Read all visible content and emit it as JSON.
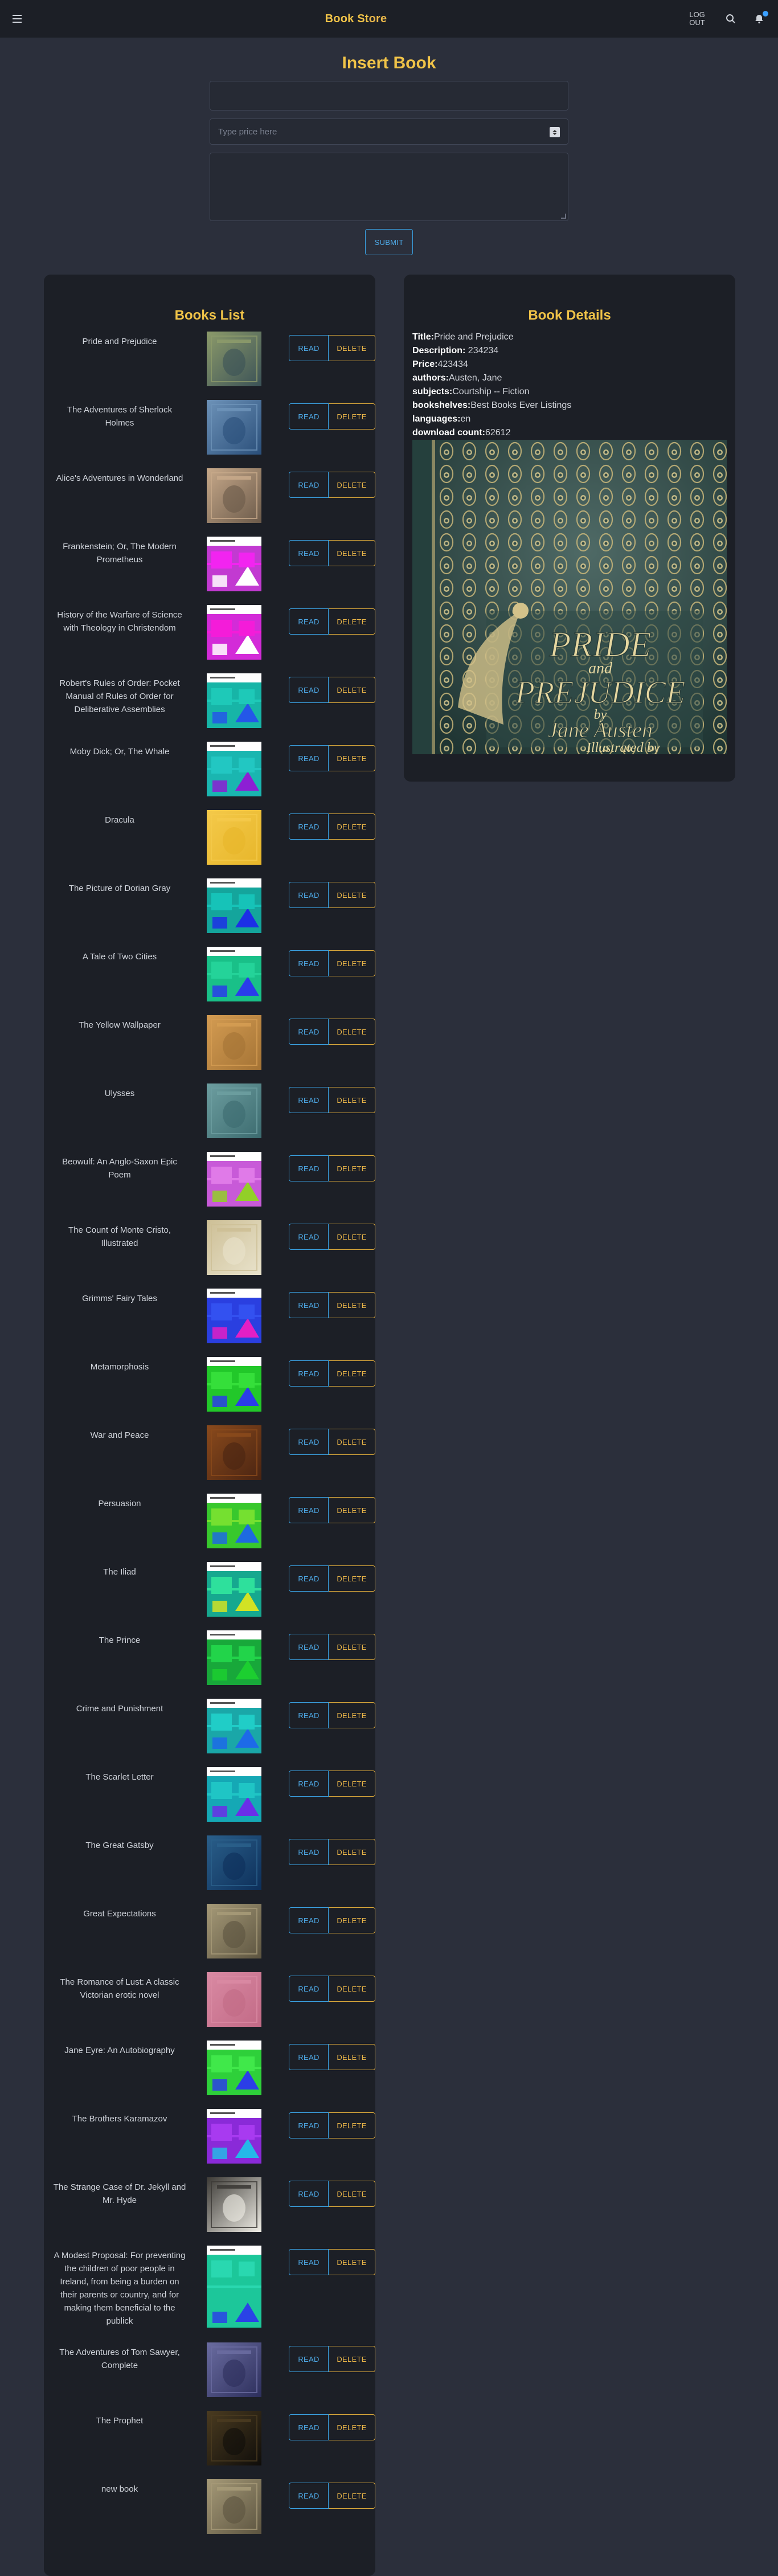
{
  "navbar": {
    "brand_main": "Book St",
    "brand_tail": "ore",
    "logout_line1": "LOG",
    "logout_line2": "OUT"
  },
  "insert_form": {
    "title": "Insert Book",
    "price_placeholder": "Type price here",
    "submit_label": "SUBMIT"
  },
  "books_list": {
    "title": "Books List",
    "read_label": "READ",
    "delete_label": "DELETE",
    "books": [
      {
        "title": "Pride and Prejudice",
        "cover": "photo",
        "c1": "#3b5257",
        "c2": "#8c9a6a"
      },
      {
        "title": "The Adventures of Sherlock Holmes",
        "cover": "photo",
        "c1": "#2a4f7a",
        "c2": "#6d92b8"
      },
      {
        "title": "Alice's Adventures in Wonderland",
        "cover": "photo",
        "c1": "#6b5a4a",
        "c2": "#c7a98a"
      },
      {
        "title": "Frankenstein; Or, The Modern Prometheus",
        "cover": "generated",
        "c1": "#c23ad1",
        "c2": "#f224f0",
        "c3": "#ffffff"
      },
      {
        "title": "History of the Warfare of Science with Theology in Christendom",
        "cover": "generated",
        "c1": "#d32bd8",
        "c2": "#f41cd9",
        "c3": "#ffffff"
      },
      {
        "title": "Robert's Rules of Order: Pocket Manual of Rules of Order for Deliberative Assemblies",
        "cover": "generated",
        "c1": "#17b5a7",
        "c2": "#1ec9b8",
        "c3": "#2457e8"
      },
      {
        "title": "Moby Dick; Or, The Whale",
        "cover": "generated",
        "c1": "#1ab6b0",
        "c2": "#22c7c2",
        "c3": "#8d1fd4"
      },
      {
        "title": "Dracula",
        "cover": "photo",
        "c1": "#e7b62a",
        "c2": "#f4c94a"
      },
      {
        "title": "The Picture of Dorian Gray",
        "cover": "generated",
        "c1": "#14a59c",
        "c2": "#16c3b8",
        "c3": "#1c2fe6"
      },
      {
        "title": "A Tale of Two Cities",
        "cover": "generated",
        "c1": "#19c088",
        "c2": "#24d399",
        "c3": "#2a3cea"
      },
      {
        "title": "The Yellow Wallpaper",
        "cover": "photo",
        "c1": "#a47335",
        "c2": "#d49c52"
      },
      {
        "title": "Ulysses",
        "cover": "photo",
        "c1": "#3c6b6f",
        "c2": "#6d9ea0"
      },
      {
        "title": "Beowulf: An Anglo-Saxon Epic Poem",
        "cover": "generated",
        "c1": "#c85ad8",
        "c2": "#e07ae8",
        "c3": "#92d028"
      },
      {
        "title": "The Count of Monte Cristo, Illustrated",
        "cover": "photo",
        "c1": "#e9e3cc",
        "c2": "#cdbf96"
      },
      {
        "title": "Grimms' Fairy Tales",
        "cover": "generated",
        "c1": "#2a3fe0",
        "c2": "#3351f0",
        "c3": "#e21fc5"
      },
      {
        "title": "Metamorphosis",
        "cover": "generated",
        "c1": "#22c82a",
        "c2": "#35df3a",
        "c3": "#2b3de8"
      },
      {
        "title": "War and Peace",
        "cover": "photo",
        "c1": "#4a2412",
        "c2": "#8a4a1c"
      },
      {
        "title": "Persuasion",
        "cover": "generated",
        "c1": "#38c82d",
        "c2": "#75e030",
        "c3": "#1e6ae0"
      },
      {
        "title": "The Iliad",
        "cover": "generated",
        "c1": "#16a88f",
        "c2": "#2ee09c",
        "c3": "#d2e224"
      },
      {
        "title": "The Prince",
        "cover": "generated",
        "c1": "#18a83a",
        "c2": "#22d44a",
        "c3": "#1ccf30"
      },
      {
        "title": "Crime and Punishment",
        "cover": "generated",
        "c1": "#1aa7a8",
        "c2": "#20cdc7",
        "c3": "#1d6ae8"
      },
      {
        "title": "The Scarlet Letter",
        "cover": "generated",
        "c1": "#15a8b5",
        "c2": "#1fc5c5",
        "c3": "#6a2ee8"
      },
      {
        "title": "The Great Gatsby",
        "cover": "photo",
        "c1": "#0d2f5a",
        "c2": "#2a5f8a"
      },
      {
        "title": "Great Expectations",
        "cover": "photo",
        "c1": "#5c5440",
        "c2": "#a69a78"
      },
      {
        "title": "The Romance of Lust: A classic Victorian erotic novel",
        "cover": "photo",
        "c1": "#c26a86",
        "c2": "#d98aa3"
      },
      {
        "title": "Jane Eyre: An Autobiography",
        "cover": "generated",
        "c1": "#2ed03a",
        "c2": "#40e84a",
        "c3": "#2b3ee8"
      },
      {
        "title": "The Brothers Karamazov",
        "cover": "generated",
        "c1": "#8a2ad8",
        "c2": "#a83af0",
        "c3": "#25b8e8"
      },
      {
        "title": "The Strange Case of Dr. Jekyll and Mr. Hyde",
        "cover": "photo",
        "c1": "#f0eee6",
        "c2": "#3c3a36"
      },
      {
        "title": "A Modest Proposal: For preventing the children of poor people in Ireland, from being a burden on their parents or country, and for making them beneficial to the publick",
        "cover": "generated",
        "tall": true,
        "c1": "#1cc79a",
        "c2": "#29d8b0",
        "c3": "#2a42e6"
      },
      {
        "title": "The Adventures of Tom Sawyer, Complete",
        "cover": "photo",
        "c1": "#2d2f5c",
        "c2": "#6a6ca0"
      },
      {
        "title": "The Prophet",
        "cover": "photo",
        "c1": "#0f0d0a",
        "c2": "#4a3b20"
      },
      {
        "title": "new book",
        "cover": "photo",
        "c1": "#5c5440",
        "c2": "#a69a78"
      }
    ]
  },
  "book_details": {
    "title": "Book Details",
    "rows": [
      {
        "label": "Title:",
        "value": "Pride and Prejudice"
      },
      {
        "label": "Description:",
        "value": " 234234"
      },
      {
        "label": "Price:",
        "value": "423434"
      },
      {
        "label": "authors:",
        "value": "Austen, Jane"
      },
      {
        "label": "subjects:",
        "value": "Courtship -- Fiction"
      },
      {
        "label": "bookshelves:",
        "value": "Best Books Ever Listings"
      },
      {
        "label": "languages:",
        "value": "en"
      },
      {
        "label": "download count:",
        "value": "62612"
      }
    ],
    "cover_line1": "PRIDE",
    "cover_line2": "and",
    "cover_line3": "PREJUDICE",
    "cover_line4": "by",
    "cover_line5": "Jane Austen",
    "cover_line6": "Illustrated by"
  }
}
